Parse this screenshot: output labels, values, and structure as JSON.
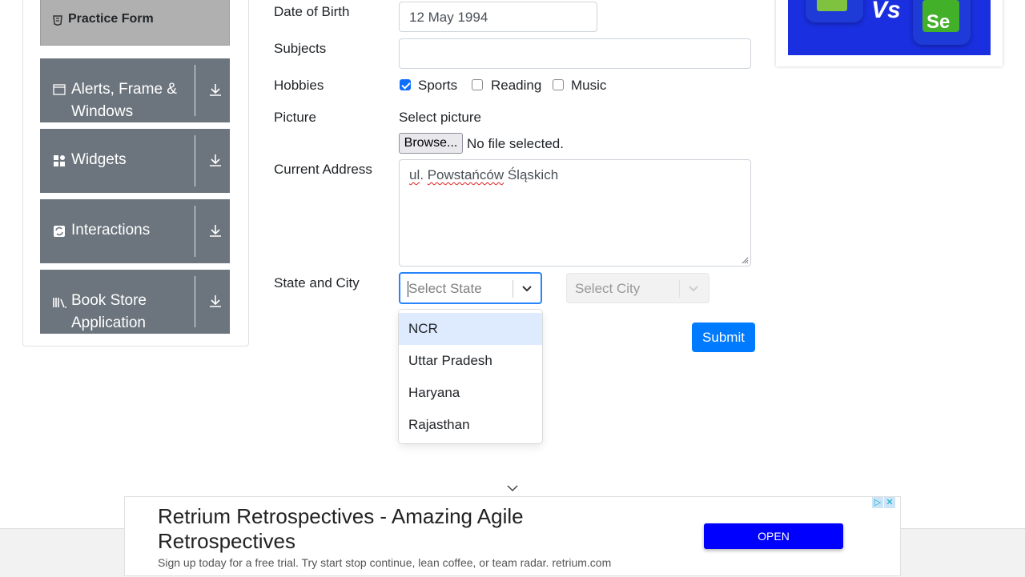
{
  "sidebar": {
    "practice_form": {
      "label": "Practice Form",
      "icon": "form-icon"
    },
    "groups": [
      {
        "label": "Alerts, Frame & Windows",
        "icon": "window-icon"
      },
      {
        "label": "Widgets",
        "icon": "widgets-icon"
      },
      {
        "label": "Interactions",
        "icon": "interactions-icon"
      },
      {
        "label": "Book Store Application",
        "icon": "books-icon"
      }
    ]
  },
  "form": {
    "dob": {
      "label": "Date of Birth",
      "value": "12 May 1994"
    },
    "subjects": {
      "label": "Subjects",
      "value": ""
    },
    "hobbies": {
      "label": "Hobbies",
      "options": [
        {
          "label": "Sports",
          "checked": true
        },
        {
          "label": "Reading",
          "checked": false
        },
        {
          "label": "Music",
          "checked": false
        }
      ]
    },
    "picture": {
      "label": "Picture",
      "select_label": "Select picture",
      "browse_label": "Browse...",
      "file_status": "No file selected."
    },
    "address": {
      "label": "Current Address",
      "value_part1": "ul",
      "value_part2": ". ",
      "value_part3": "Powstańców",
      "value_part4": " Śląskich"
    },
    "state_city": {
      "label": "State and City",
      "state_placeholder": "Select State",
      "city_placeholder": "Select City",
      "state_options": [
        "NCR",
        "Uttar Pradesh",
        "Haryana",
        "Rajasthan"
      ],
      "highlighted_option": "NCR"
    },
    "submit_label": "Submit"
  },
  "ad": {
    "title": "Retrium Retrospectives - Amazing Agile Retrospectives",
    "description": "Sign up today for a free trial. Try start stop continue, lean coffee, or team radar. retrium.com",
    "open_label": "OPEN",
    "top_ad_text": "Vs",
    "top_ad_logo": "Se"
  },
  "colors": {
    "primary": "#007bff",
    "sidebar_group": "#6c757d",
    "ad_button": "#0000ff",
    "focus_border": "#2684ff"
  }
}
